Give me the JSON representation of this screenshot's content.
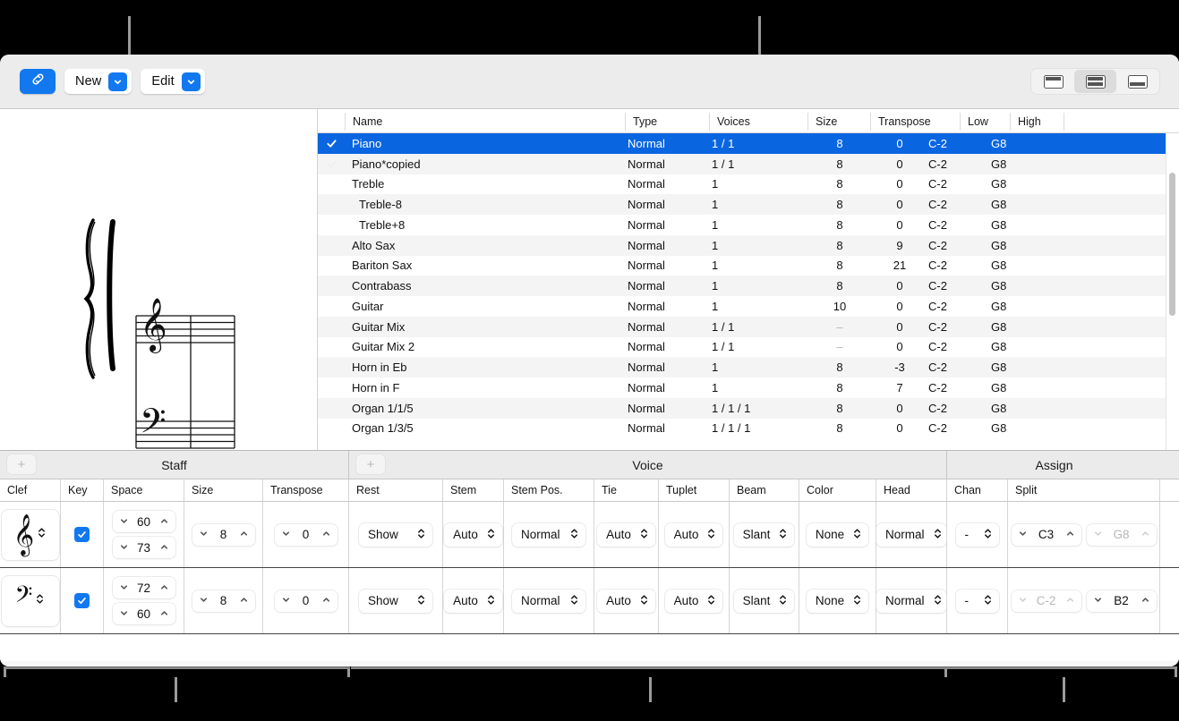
{
  "toolbar": {
    "link_icon": "link-icon",
    "new_label": "New",
    "edit_label": "Edit",
    "chevron_icon": "chevron-down-icon",
    "view_modes": [
      "view-top-icon",
      "view-split-icon",
      "view-bottom-icon"
    ],
    "active_view_index": 1,
    "accent_color": "#1178f0"
  },
  "preview": {
    "description": "grand-staff-preview",
    "clefs": [
      "treble-clef",
      "bass-clef"
    ]
  },
  "table": {
    "columns": [
      "Name",
      "Type",
      "Voices",
      "Size",
      "Transpose",
      "Low",
      "High"
    ],
    "rows": [
      {
        "check": true,
        "name": "Piano",
        "type": "Normal",
        "voices": "1 / 1",
        "size": "8",
        "transpose": "0",
        "low": "C-2",
        "high": "G8",
        "selected": true,
        "indent": 0,
        "size_dim": false
      },
      {
        "check": true,
        "name": "Piano*copied",
        "type": "Normal",
        "voices": "1 / 1",
        "size": "8",
        "transpose": "0",
        "low": "C-2",
        "high": "G8",
        "selected": false,
        "indent": 0,
        "size_dim": false,
        "check_dim": true
      },
      {
        "check": false,
        "name": "Treble",
        "type": "Normal",
        "voices": "1",
        "size": "8",
        "transpose": "0",
        "low": "C-2",
        "high": "G8",
        "selected": false,
        "indent": 0,
        "size_dim": false
      },
      {
        "check": false,
        "name": "Treble-8",
        "type": "Normal",
        "voices": "1",
        "size": "8",
        "transpose": "0",
        "low": "C-2",
        "high": "G8",
        "selected": false,
        "indent": 1,
        "size_dim": false
      },
      {
        "check": false,
        "name": "Treble+8",
        "type": "Normal",
        "voices": "1",
        "size": "8",
        "transpose": "0",
        "low": "C-2",
        "high": "G8",
        "selected": false,
        "indent": 1,
        "size_dim": false
      },
      {
        "check": false,
        "name": "Alto Sax",
        "type": "Normal",
        "voices": "1",
        "size": "8",
        "transpose": "9",
        "low": "C-2",
        "high": "G8",
        "selected": false,
        "indent": 0,
        "size_dim": false
      },
      {
        "check": false,
        "name": "Bariton Sax",
        "type": "Normal",
        "voices": "1",
        "size": "8",
        "transpose": "21",
        "low": "C-2",
        "high": "G8",
        "selected": false,
        "indent": 0,
        "size_dim": false
      },
      {
        "check": false,
        "name": "Contrabass",
        "type": "Normal",
        "voices": "1",
        "size": "8",
        "transpose": "0",
        "low": "C-2",
        "high": "G8",
        "selected": false,
        "indent": 0,
        "size_dim": false
      },
      {
        "check": false,
        "name": "Guitar",
        "type": "Normal",
        "voices": "1",
        "size": "10",
        "transpose": "0",
        "low": "C-2",
        "high": "G8",
        "selected": false,
        "indent": 0,
        "size_dim": false
      },
      {
        "check": false,
        "name": "Guitar Mix",
        "type": "Normal",
        "voices": "1 / 1",
        "size": "–",
        "transpose": "0",
        "low": "C-2",
        "high": "G8",
        "selected": false,
        "indent": 0,
        "size_dim": true
      },
      {
        "check": false,
        "name": "Guitar Mix 2",
        "type": "Normal",
        "voices": "1 / 1",
        "size": "–",
        "transpose": "0",
        "low": "C-2",
        "high": "G8",
        "selected": false,
        "indent": 0,
        "size_dim": true
      },
      {
        "check": false,
        "name": "Horn in Eb",
        "type": "Normal",
        "voices": "1",
        "size": "8",
        "transpose": "-3",
        "low": "C-2",
        "high": "G8",
        "selected": false,
        "indent": 0,
        "size_dim": false
      },
      {
        "check": false,
        "name": "Horn in F",
        "type": "Normal",
        "voices": "1",
        "size": "8",
        "transpose": "7",
        "low": "C-2",
        "high": "G8",
        "selected": false,
        "indent": 0,
        "size_dim": false
      },
      {
        "check": false,
        "name": "Organ 1/1/5",
        "type": "Normal",
        "voices": "1 / 1 / 1",
        "size": "8",
        "transpose": "0",
        "low": "C-2",
        "high": "G8",
        "selected": false,
        "indent": 0,
        "size_dim": false
      },
      {
        "check": false,
        "name": "Organ 1/3/5",
        "type": "Normal",
        "voices": "1 / 1 / 1",
        "size": "8",
        "transpose": "0",
        "low": "C-2",
        "high": "G8",
        "selected": false,
        "indent": 0,
        "size_dim": false
      }
    ]
  },
  "editor": {
    "groups": [
      {
        "title": "Staff",
        "has_add": true,
        "add_label": "+"
      },
      {
        "title": "Voice",
        "has_add": true,
        "add_label": "+"
      },
      {
        "title": "Assign",
        "has_add": false,
        "add_label": ""
      }
    ],
    "columns": [
      "Clef",
      "Key",
      "Space",
      "Size",
      "Transpose",
      "Rest",
      "Stem",
      "Stem Pos.",
      "Tie",
      "Tuplet",
      "Beam",
      "Color",
      "Head",
      "Chan",
      "Split"
    ],
    "rows": [
      {
        "clef": "treble-clef",
        "key_checked": true,
        "space_top": "60",
        "space_bottom": "73",
        "size": "8",
        "transpose": "0",
        "rest": "Show",
        "stem": "Auto",
        "stem_pos": "Normal",
        "tie": "Auto",
        "tuplet": "Auto",
        "beam": "Slant",
        "color": "None",
        "head": "Normal",
        "chan": "-",
        "split_low": "C3",
        "split_high": "G8",
        "split_low_dim": false,
        "split_high_dim": true
      },
      {
        "clef": "bass-clef",
        "key_checked": true,
        "space_top": "72",
        "space_bottom": "60",
        "size": "8",
        "transpose": "0",
        "rest": "Show",
        "stem": "Auto",
        "stem_pos": "Normal",
        "tie": "Auto",
        "tuplet": "Auto",
        "beam": "Slant",
        "color": "None",
        "head": "Normal",
        "chan": "-",
        "split_low": "C-2",
        "split_high": "B2",
        "split_low_dim": true,
        "split_high_dim": false
      }
    ]
  }
}
